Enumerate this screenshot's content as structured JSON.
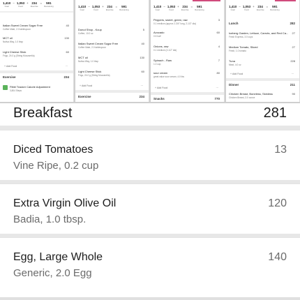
{
  "thumbnails": [
    {
      "stats": {
        "goal": "1,410",
        "food": "1,053",
        "exercise": "234",
        "remaining": "591",
        "goal_label": "Goal",
        "food_label": "Food",
        "exercise_label": "Exercise",
        "remaining_label": "Remaining"
      },
      "ops": {
        "minus": "−",
        "plus": "+",
        "equals": "="
      },
      "rows": [
        {
          "title": "Italian Sweet Cream Sugar Free",
          "sub": "Coffee Mate, 2.0 tablespoon",
          "cal": "40"
        },
        {
          "title": "MCT oil",
          "sub": "Nutiva Way, 1.0 tbsp",
          "cal": "130"
        },
        {
          "title": "Light Cheese Stick",
          "sub": "Frigo, 24.0 g (String Mozzarella)",
          "cal": "60"
        }
      ],
      "add_food": "Add Food",
      "more": "···",
      "exercise_label": "Exercise",
      "exercise_total": "234",
      "exercise_row": {
        "title": "Fitbit Tracker Calorie Adjustment",
        "sub": "3,804 Steps"
      }
    },
    {
      "stats": {
        "goal": "1,410",
        "food": "1,053",
        "exercise": "234",
        "remaining": "591",
        "goal_label": "Goal",
        "food_label": "Food",
        "exercise_label": "Exercise",
        "remaining_label": "Remaining"
      },
      "ops": {
        "minus": "−",
        "plus": "+",
        "equals": "="
      },
      "rows": [
        {
          "title": "Donut Shop - Kcup",
          "sub": "Coffee, 10.0 oz",
          "cal": "5"
        },
        {
          "title": "Italian Sweet Cream Sugar Free",
          "sub": "Coffee Mate, 2.0 tablespoon",
          "cal": "40"
        },
        {
          "title": "MCT oil",
          "sub": "Nutiva Way, 1.0 tbsp",
          "cal": "130"
        },
        {
          "title": "Light Cheese Stick",
          "sub": "Frigo, 24.0 g (String Mozzarella)",
          "cal": "60"
        }
      ],
      "add_food": "Add Food",
      "more": "···",
      "exercise_label": "Exercise",
      "exercise_total": "234"
    },
    {
      "stats": {
        "goal": "1,410",
        "food": "1,053",
        "exercise": "234",
        "remaining": "591",
        "goal_label": "Goal",
        "food_label": "Food",
        "exercise_label": "Exercise",
        "remaining_label": "Remaining"
      },
      "ops": {
        "minus": "−",
        "plus": "+",
        "equals": "="
      },
      "rows": [
        {
          "title": "Peppers, sweet, green, raw",
          "sub": "0.1 medium (approx 2-3/4\" long, 2-1/2\" dia)",
          "cal": "3"
        },
        {
          "title": "Avocado",
          "sub": "0.5 half",
          "cal": "60"
        },
        {
          "title": "Onions, raw",
          "sub": "0.1 medium (2-1/2\" dia)",
          "cal": "4"
        },
        {
          "title": "Spinach - Raw",
          "sub": "1.0 cup",
          "cal": "7"
        },
        {
          "title": "sour cream",
          "sub": "great value sour cream, 4.0 tbs",
          "cal": "80"
        }
      ],
      "add_food": "Add Food",
      "more": "···",
      "snacks_label": "Snacks",
      "snacks_total": "770"
    },
    {
      "stats": {
        "goal": "1,410",
        "food": "1,053",
        "exercise": "234",
        "remaining": "591",
        "goal_label": "Goal",
        "food_label": "Food",
        "exercise_label": "Exercise",
        "remaining_label": "Remaining"
      },
      "ops": {
        "minus": "−",
        "plus": "+",
        "equals": "="
      },
      "lunch_label": "Lunch",
      "lunch_total": "282",
      "rows": [
        {
          "title": "Iceberg Garden, Lettuce, Carrots, and Red Ca...",
          "sub": "Fresh Express, 3.0 cups",
          "cal": "27"
        },
        {
          "title": "Medium Tomato, Sliced",
          "sub": "Fresh, 1.0 tomato",
          "cal": "27"
        },
        {
          "title": "Tuna",
          "sub": "Meat, 4.0 oz",
          "cal": "228"
        }
      ],
      "add_food": "Add Food",
      "more": "···",
      "dinner_label": "Dinner",
      "dinner_total": "211",
      "dinner_row": {
        "title": "Chicken Breast, Boneless, Skinless",
        "sub": "Chicken Breast, 3.0 ounce",
        "cal": "90"
      }
    }
  ],
  "meal": {
    "title": "Breakfast",
    "total": "281",
    "items": [
      {
        "name": "Diced Tomatoes",
        "detail": "Vine Ripe, 0.2 cup",
        "calories": "13"
      },
      {
        "name": "Extra Virgin Olive Oil",
        "detail": "Badia, 1.0 tbsp.",
        "calories": "120"
      },
      {
        "name": "Egg, Large Whole",
        "detail": "Generic, 2.0 Egg",
        "calories": "140"
      }
    ]
  },
  "colors": {
    "remaining_green": "#4caf50",
    "accent_pink": "#d04a7c"
  }
}
